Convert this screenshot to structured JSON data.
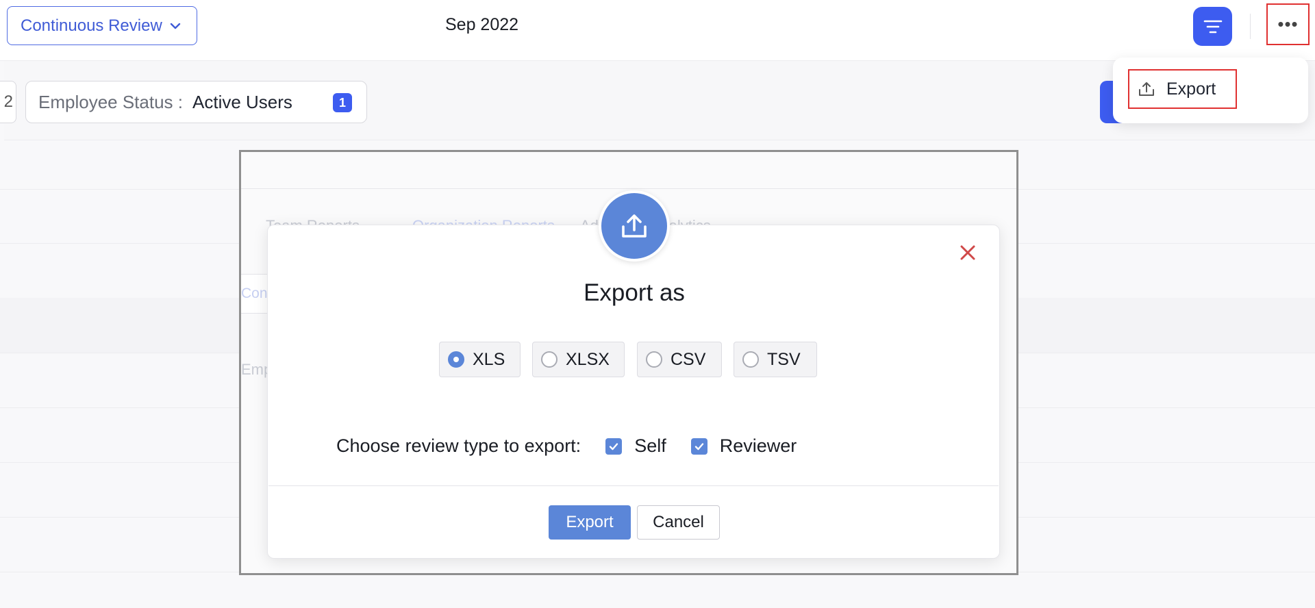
{
  "header": {
    "review_dropdown_label": "Continuous Review",
    "period": "Sep 2022",
    "more_label": "•••"
  },
  "filters": {
    "truncated_chip_text": "2",
    "status_label": "Employee Status :",
    "status_value": "Active Users",
    "status_badge": "1"
  },
  "menu": {
    "export_label": "Export"
  },
  "background": {
    "tabs": [
      "Team Reports",
      "Organization Reports",
      "Advanced Analytics"
    ],
    "input_fragment": "Contin",
    "row_fragment": "Emp"
  },
  "dialog": {
    "title": "Export as",
    "formats": [
      {
        "label": "XLS",
        "selected": true
      },
      {
        "label": "XLSX",
        "selected": false
      },
      {
        "label": "CSV",
        "selected": false
      },
      {
        "label": "TSV",
        "selected": false
      }
    ],
    "review_type_label": "Choose review type to export:",
    "review_types": [
      {
        "label": "Self",
        "checked": true
      },
      {
        "label": "Reviewer",
        "checked": true
      }
    ],
    "export_button": "Export",
    "cancel_button": "Cancel"
  },
  "colors": {
    "primary": "#3d5cf0",
    "dialog_accent": "#5b86d8",
    "highlight_border": "#e03030",
    "close_icon": "#d04848"
  }
}
